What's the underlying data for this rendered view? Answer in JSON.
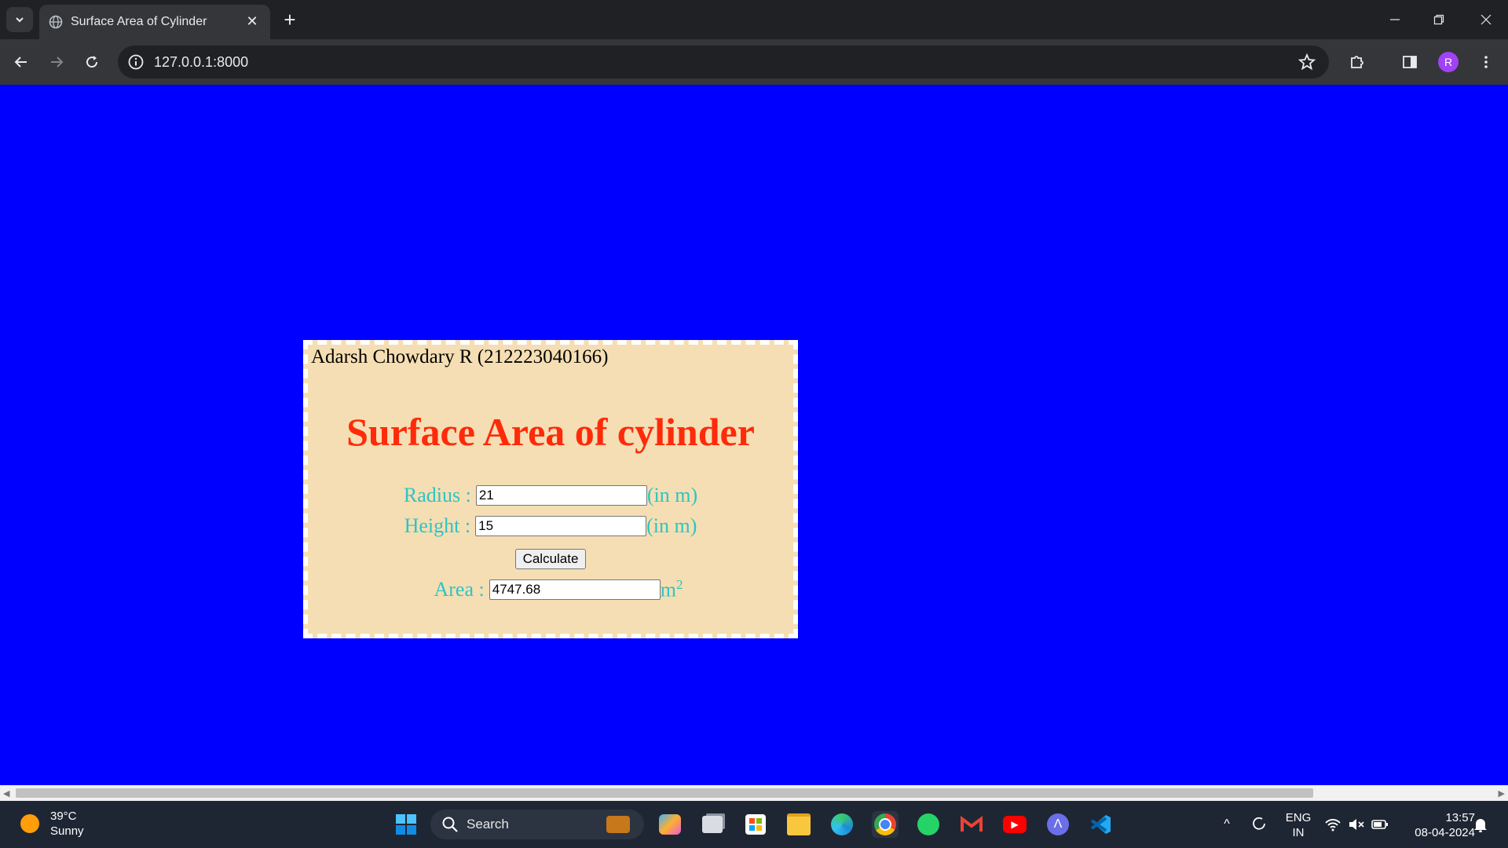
{
  "browser": {
    "tab_title": "Surface Area of Cylinder",
    "url": "127.0.0.1:8000",
    "profile_initial": "R"
  },
  "page": {
    "author": "Adarsh Chowdary R (212223040166)",
    "heading": "Surface Area of cylinder",
    "radius": {
      "label": "Radius :",
      "value": "21",
      "unit": "(in m)"
    },
    "height": {
      "label": "Height :",
      "value": "15",
      "unit": "(in m)"
    },
    "calculate_label": "Calculate",
    "area": {
      "label": "Area :",
      "value": "4747.68",
      "unit": "m",
      "unit_sup": "2"
    },
    "colors": {
      "background": "#0000ff",
      "card": "#f5deb3",
      "heading": "#ff2a0a",
      "labels": "#2ec4c4"
    }
  },
  "taskbar": {
    "weather_temp": "39°C",
    "weather_desc": "Sunny",
    "search_label": "Search",
    "lang_top": "ENG",
    "lang_bottom": "IN",
    "time": "13:57",
    "date": "08-04-2024"
  }
}
